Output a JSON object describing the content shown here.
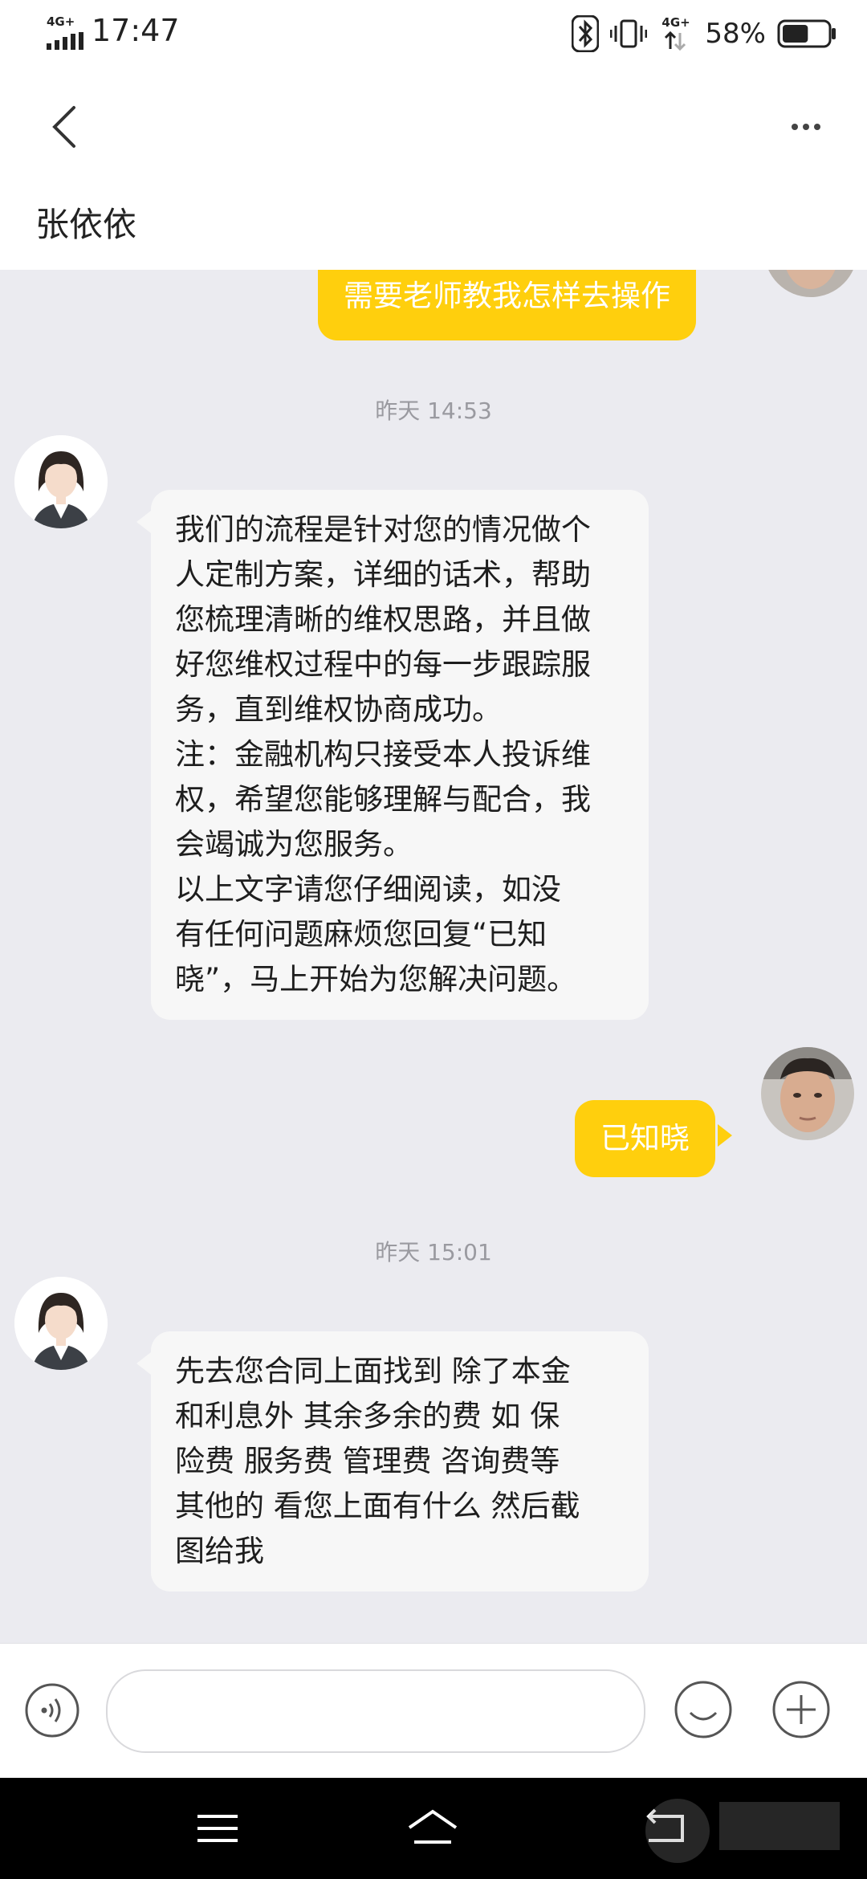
{
  "status_bar": {
    "network_type": "4G+",
    "time": "17:47",
    "network_type_2": "4G+",
    "battery_percent": "58%",
    "battery_level": 0.58,
    "icons": [
      "signal-icon",
      "bluetooth-icon",
      "vibrate-icon",
      "battery-icon"
    ]
  },
  "header": {
    "back_icon": "chevron-left-icon",
    "more_icon": "more-horizontal-icon",
    "contact_name": "张依依"
  },
  "messages": [
    {
      "from": "me",
      "text": "需要老师教我怎样去操作"
    },
    {
      "type": "timestamp",
      "text": "昨天 14:53"
    },
    {
      "from": "agent",
      "lines": [
        "我们的流程是针对您的情况做个",
        "人定制方案，详细的话术，帮助",
        "您梳理清晰的维权思路，并且做",
        "好您维权过程中的每一步跟踪服",
        "务，直到维权协商成功。",
        "注：金融机构只接受本人投诉维",
        "权，希望您能够理解与配合，我",
        "会竭诚为您服务。",
        "以上文字请您仔细阅读，如没",
        "有任何问题麻烦您回复“已知",
        "晓”，马上开始为您解决问题。"
      ]
    },
    {
      "from": "me",
      "text": "已知晓"
    },
    {
      "type": "timestamp",
      "text": "昨天 15:01"
    },
    {
      "from": "agent",
      "lines": [
        "先去您合同上面找到 除了本金",
        "和利息外  其余多余的费  如 保",
        "险费  服务费  管理费 咨询费等",
        "其他的  看您上面有什么 然后截",
        "图给我"
      ]
    }
  ],
  "input_bar": {
    "voice_icon": "voice-icon",
    "input_value": "",
    "emoji_icon": "emoji-icon",
    "plus_icon": "plus-icon"
  },
  "system_nav": {
    "icons": [
      "menu-icon",
      "home-icon",
      "back-icon"
    ]
  },
  "colors": {
    "accent": "#ffcf0d",
    "chat_background": "#ebebf0",
    "agent_bubble": "#f7f7f7"
  }
}
